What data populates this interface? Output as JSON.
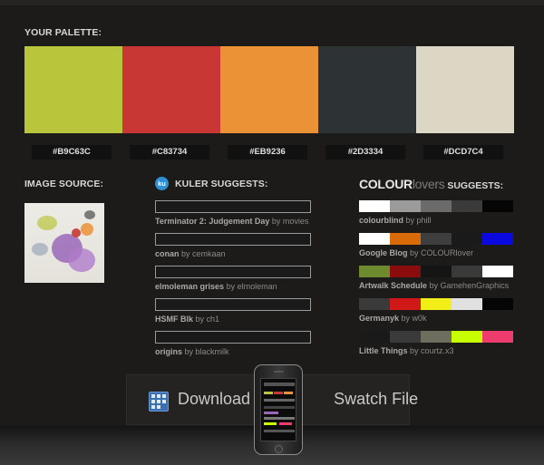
{
  "palette_section": {
    "title": "YOUR PALETTE:",
    "swatches": [
      {
        "hex": "#B9C63C",
        "color": "#B9C63C"
      },
      {
        "hex": "#C83734",
        "color": "#C83734"
      },
      {
        "hex": "#EB9236",
        "color": "#EB9236"
      },
      {
        "hex": "#2D3334",
        "color": "#2D3334"
      },
      {
        "hex": "#DCD7C4",
        "color": "#DCD7C4"
      }
    ]
  },
  "image_source": {
    "title": "IMAGE SOURCE:"
  },
  "kuler": {
    "logo_text": "ku",
    "title": "KULER SUGGESTS:",
    "items": [
      {
        "name": "Terminator 2: Judgement Day",
        "by": "by movies"
      },
      {
        "name": "conan",
        "by": "by cemkaan"
      },
      {
        "name": "elmoleman grises",
        "by": "by elmoleman"
      },
      {
        "name": "HSMF Blk",
        "by": "by ch1"
      },
      {
        "name": "origins",
        "by": "by blackmilk"
      }
    ]
  },
  "colourlovers": {
    "logo_main": "COLOUR",
    "logo_light": "lovers",
    "title": " SUGGESTS:",
    "items": [
      {
        "name": "colourblind",
        "by": "by phill",
        "colors": [
          "#FFFFFF",
          "#9B9B9B",
          "#6B6B6B",
          "#3A3A3A",
          "#050505"
        ]
      },
      {
        "name": "Google Blog",
        "by": "by COLOURlover",
        "colors": [
          "#FFFFFF",
          "#D86A08",
          "#3E3E3E",
          "#1A1A1A",
          "#0A0AE0"
        ]
      },
      {
        "name": "Artwalk Schedule",
        "by": "by GamehenGraphics",
        "colors": [
          "#6E8A2E",
          "#8B0C0C",
          "#151515",
          "#3A3A3A",
          "#FFFFFF"
        ]
      },
      {
        "name": "Germanyk",
        "by": "by w0k",
        "colors": [
          "#3A3A3A",
          "#D01818",
          "#F2EE18",
          "#E0E0E0",
          "#050505"
        ]
      },
      {
        "name": "Little Things",
        "by": "by courtz.x3",
        "colors": [
          "#1A1A1A",
          "#3A3A3A",
          "#6E6E5E",
          "#C8FF00",
          "#EE3C6E"
        ]
      }
    ]
  },
  "download": {
    "label_left": "Download",
    "label_right": "Swatch File"
  }
}
